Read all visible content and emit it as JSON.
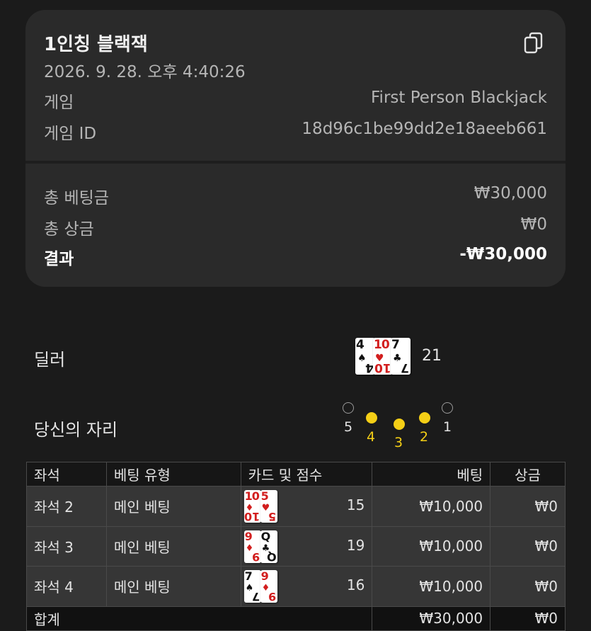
{
  "header": {
    "title": "1인칭 블랙잭",
    "datetime": "2026. 9. 28. 오후 4:40:26",
    "game_label": "게임",
    "game_value": "First Person Blackjack",
    "game_id_label": "게임 ID",
    "game_id_value": "18d96c1be99dd2e18aeeb661",
    "copy_icon": "copy-icon"
  },
  "summary": {
    "total_bet_label": "총 베팅금",
    "total_bet_value": "₩30,000",
    "total_win_label": "총 상금",
    "total_win_value": "₩0",
    "result_label": "결과",
    "result_value": "-₩30,000"
  },
  "dealer": {
    "label": "딜러",
    "score": "21",
    "cards": [
      {
        "rank": "4",
        "suit": "♠",
        "color": "#111111"
      },
      {
        "rank": "10",
        "suit": "♥",
        "color": "#d21e1e"
      },
      {
        "rank": "7",
        "suit": "♣",
        "color": "#111111"
      }
    ]
  },
  "seats": {
    "label": "당신의 자리",
    "items": [
      {
        "num": "5",
        "taken": false
      },
      {
        "num": "4",
        "taken": true
      },
      {
        "num": "3",
        "taken": true
      },
      {
        "num": "2",
        "taken": true
      },
      {
        "num": "1",
        "taken": false
      }
    ],
    "accent": "#f5cf16"
  },
  "table": {
    "headers": [
      "좌석",
      "베팅 유형",
      "카드 및 점수",
      "베팅",
      "상금"
    ],
    "rows": [
      {
        "seat": "좌석 2",
        "type": "메인 베팅",
        "score": "15",
        "bet": "₩10,000",
        "win": "₩0",
        "cards": [
          {
            "rank": "10",
            "suit": "♦",
            "color": "#d21e1e"
          },
          {
            "rank": "5",
            "suit": "♥",
            "color": "#d21e1e"
          }
        ]
      },
      {
        "seat": "좌석 3",
        "type": "메인 베팅",
        "score": "19",
        "bet": "₩10,000",
        "win": "₩0",
        "cards": [
          {
            "rank": "9",
            "suit": "♦",
            "color": "#d21e1e"
          },
          {
            "rank": "Q",
            "suit": "♣",
            "color": "#111111"
          }
        ]
      },
      {
        "seat": "좌석 4",
        "type": "메인 베팅",
        "score": "16",
        "bet": "₩10,000",
        "win": "₩0",
        "cards": [
          {
            "rank": "7",
            "suit": "♠",
            "color": "#111111"
          },
          {
            "rank": "9",
            "suit": "♦",
            "color": "#d21e1e"
          }
        ]
      }
    ],
    "footer": {
      "label": "합계",
      "bet": "₩30,000",
      "win": "₩0"
    }
  }
}
